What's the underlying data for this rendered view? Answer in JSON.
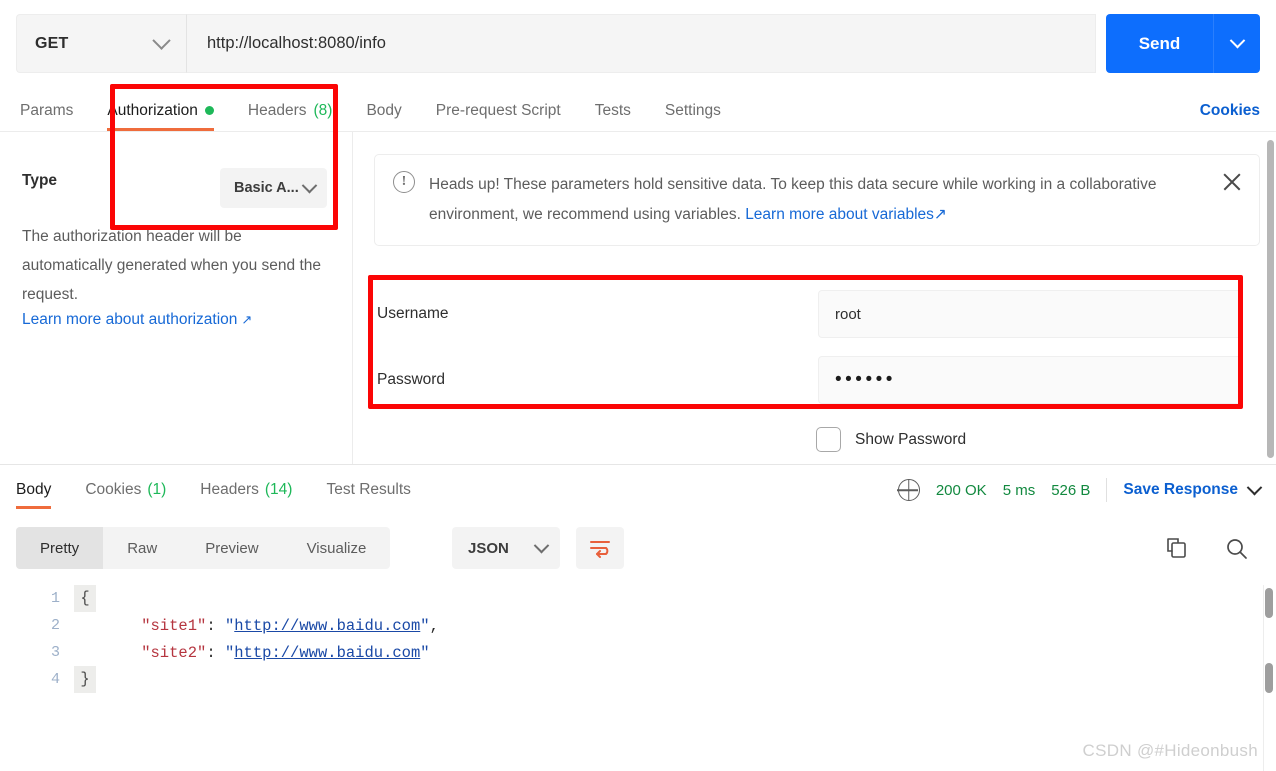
{
  "request": {
    "method": "GET",
    "method_icon": "chevron-down-icon",
    "url": "http://localhost:8080/info",
    "send_label": "Send",
    "send_caret_icon": "chevron-down-icon"
  },
  "request_tabs": {
    "items": [
      {
        "label": "Params",
        "active": false,
        "indicator": "",
        "count": ""
      },
      {
        "label": "Authorization",
        "active": true,
        "indicator": "green-dot",
        "count": ""
      },
      {
        "label": "Headers",
        "active": false,
        "indicator": "",
        "count": "(8)"
      },
      {
        "label": "Body",
        "active": false,
        "indicator": "",
        "count": ""
      },
      {
        "label": "Pre-request Script",
        "active": false,
        "indicator": "",
        "count": ""
      },
      {
        "label": "Tests",
        "active": false,
        "indicator": "",
        "count": ""
      },
      {
        "label": "Settings",
        "active": false,
        "indicator": "",
        "count": ""
      }
    ],
    "cookies_label": "Cookies"
  },
  "auth": {
    "type_label": "Type",
    "type_value": "Basic A...",
    "type_caret_icon": "chevron-down-icon",
    "description": "The authorization header will be automatically generated when you send the request.",
    "learn_more_label": "Learn more about authorization",
    "learn_more_arrow": "↗",
    "notice": {
      "icon": "exclamation-circle-icon",
      "text_part1": "Heads up! These parameters hold sensitive data. To keep this data secure while working in a collaborative environment, we recommend using variables. ",
      "link_label": "Learn more about variables",
      "link_arrow": "↗",
      "close_icon": "close-icon"
    },
    "fields": [
      {
        "label": "Username",
        "value": "root",
        "masked": false
      },
      {
        "label": "Password",
        "value": "••••••",
        "masked": true
      }
    ],
    "show_password_label": "Show Password",
    "show_password_checked": false
  },
  "annotations": {
    "color": "#fb0505",
    "boxes": [
      {
        "name": "authorization-tab-and-type"
      },
      {
        "name": "username-password-fields"
      }
    ]
  },
  "response": {
    "tabs": [
      {
        "label": "Body",
        "count": "",
        "active": true
      },
      {
        "label": "Cookies",
        "count": "(1)",
        "active": false
      },
      {
        "label": "Headers",
        "count": "(14)",
        "active": false
      },
      {
        "label": "Test Results",
        "count": "",
        "active": false
      }
    ],
    "status_icon": "globe-icon",
    "status": "200 OK",
    "time": "5 ms",
    "size": "526 B",
    "save_label": "Save Response",
    "save_caret_icon": "chevron-down-icon",
    "format_tabs": [
      {
        "label": "Pretty",
        "active": true
      },
      {
        "label": "Raw",
        "active": false
      },
      {
        "label": "Preview",
        "active": false
      },
      {
        "label": "Visualize",
        "active": false
      }
    ],
    "language": "JSON",
    "language_caret_icon": "chevron-down-icon",
    "wrap_icon": "wrap-lines-icon",
    "copy_icon": "copy-icon",
    "search_icon": "search-icon",
    "body_lines": [
      {
        "num": "1",
        "fold": "{",
        "fold_marked": true,
        "tokens": []
      },
      {
        "num": "2",
        "fold": "",
        "fold_marked": false,
        "tokens": [
          {
            "t": "key",
            "v": "    \"site1\""
          },
          {
            "t": "pun",
            "v": ": "
          },
          {
            "t": "str",
            "v": "\""
          },
          {
            "t": "url",
            "v": "http://www.baidu.com"
          },
          {
            "t": "str",
            "v": "\""
          },
          {
            "t": "pun",
            "v": ","
          }
        ]
      },
      {
        "num": "3",
        "fold": "",
        "fold_marked": false,
        "tokens": [
          {
            "t": "key",
            "v": "    \"site2\""
          },
          {
            "t": "pun",
            "v": ": "
          },
          {
            "t": "str",
            "v": "\""
          },
          {
            "t": "url",
            "v": "http://www.baidu.com"
          },
          {
            "t": "str",
            "v": "\""
          }
        ]
      },
      {
        "num": "4",
        "fold": "}",
        "fold_marked": true,
        "tokens": []
      }
    ]
  },
  "watermark": "CSDN @#Hideonbush"
}
